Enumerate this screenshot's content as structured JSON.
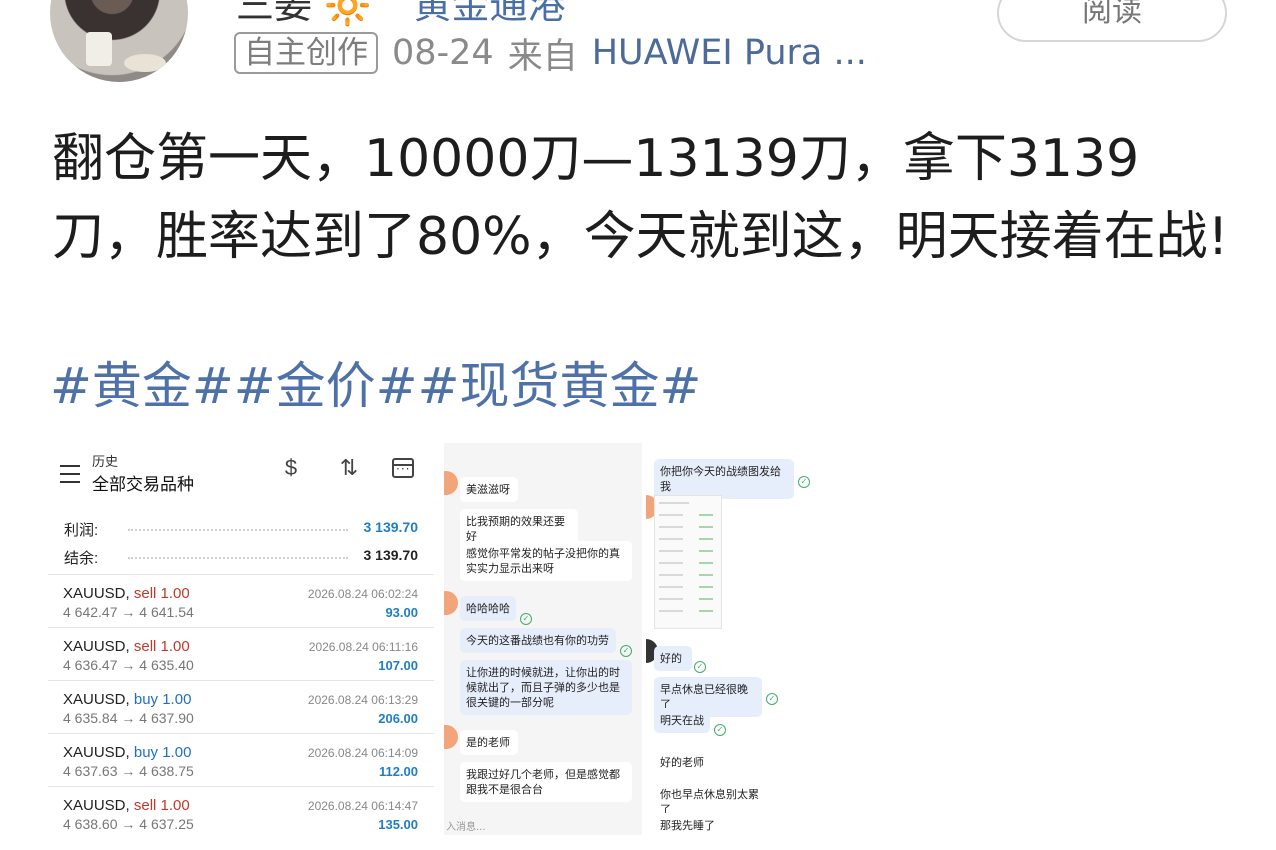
{
  "header": {
    "username": "三姜",
    "vip_badge": "🔆",
    "top_link": "黄金通港",
    "read_button": "阅读",
    "tag": "自主创作",
    "date": "08-24",
    "from_label": "来自",
    "device": "HUAWEI Pura ..."
  },
  "post": {
    "text": "翻仓第一天，10000刀—13139刀，拿下3139刀，胜率达到了80%，今天就到这，明天接着在战!",
    "hashtags": "#黄金##金价##现货黄金#"
  },
  "trade_panel": {
    "subtitle": "历史",
    "title": "全部交易品种",
    "profit_label": "利润:",
    "profit_value": "3 139.70",
    "balance_label": "结余:",
    "balance_value": "3 139.70",
    "rows": [
      {
        "symbol": "XAUUSD,",
        "side": "sell 1.00",
        "prices": "4 642.47 → 4 641.54",
        "time": "2026.08.24 06:02:24",
        "pl": "93.00"
      },
      {
        "symbol": "XAUUSD,",
        "side": "sell 1.00",
        "prices": "4 636.47 → 4 635.40",
        "time": "2026.08.24 06:11:16",
        "pl": "107.00"
      },
      {
        "symbol": "XAUUSD,",
        "side": "buy 1.00",
        "prices": "4 635.84 → 4 637.90",
        "time": "2026.08.24 06:13:29",
        "pl": "206.00"
      },
      {
        "symbol": "XAUUSD,",
        "side": "buy 1.00",
        "prices": "4 637.63 → 4 638.75",
        "time": "2026.08.24 06:14:09",
        "pl": "112.00"
      },
      {
        "symbol": "XAUUSD,",
        "side": "sell 1.00",
        "prices": "4 638.60 → 4 637.25",
        "time": "2026.08.24 06:14:47",
        "pl": "135.00"
      }
    ]
  },
  "chat1": {
    "messages": [
      "美滋滋呀",
      "比我预期的效果还要好",
      "感觉你平常发的帖子没把你的真实实力显示出来呀",
      "哈哈哈哈",
      "今天的这番战绩也有你的功劳",
      "让你进的时候就进，让你出的时候就出了，而且子弹的多少也是很关键的一部分呢",
      "是的老师",
      "我跟过好几个老师，但是感觉都跟我不是很合台"
    ],
    "input_hint": "入消息..."
  },
  "chat2": {
    "messages": [
      "你把你今天的战绩图发给我",
      "好的",
      "早点休息已经很晚了",
      "明天在战",
      "好的老师",
      "你也早点休息别太累了",
      "那我先睡了"
    ]
  },
  "colors": {
    "link_blue": "#4e72a8",
    "profit_blue": "#1f7ec3",
    "sell_red": "#c0392b",
    "buy_blue": "#1f6fc3",
    "chat_bubble": "#e7eefb"
  }
}
